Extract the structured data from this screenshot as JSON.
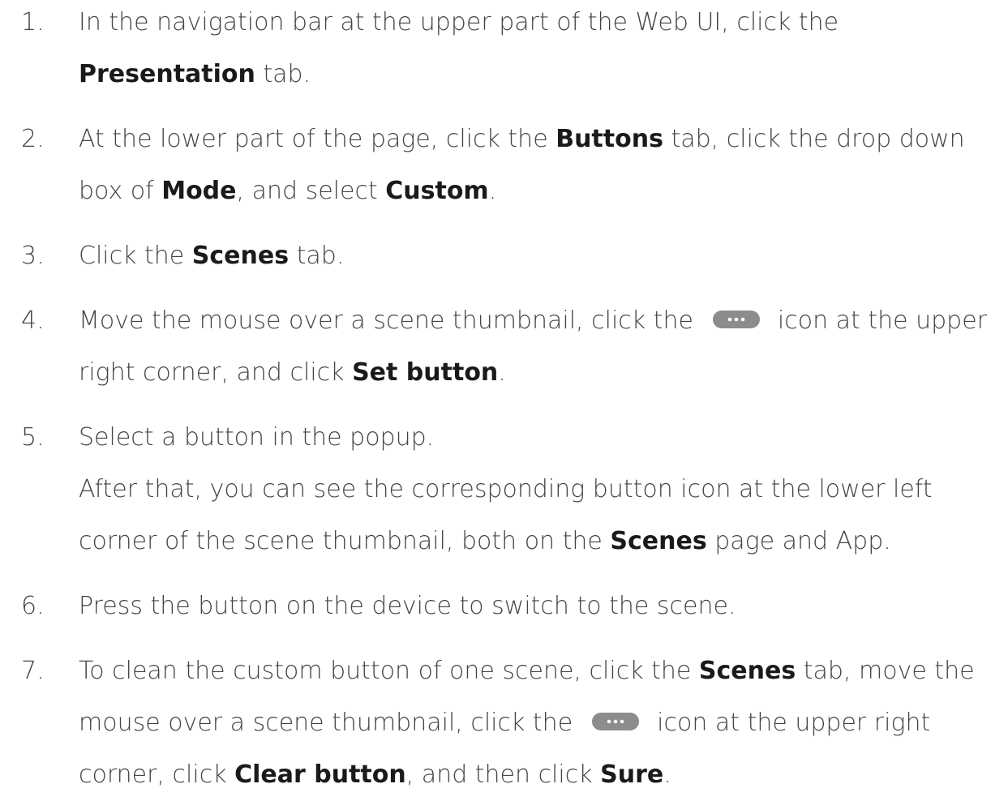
{
  "steps": [
    {
      "num": "1.",
      "lines": [
        [
          "In the navigation bar at the upper part of the Web UI, click the"
        ],
        [
          "",
          "Presentation",
          " tab."
        ]
      ]
    },
    {
      "num": "2.",
      "lines": [
        [
          "At the lower part of the page, click the ",
          "Buttons",
          " tab, click the drop down"
        ],
        [
          "box of ",
          "Mode",
          ", and select ",
          "Custom",
          "."
        ]
      ]
    },
    {
      "num": "3.",
      "lines": [
        [
          "Click the ",
          "Scenes",
          " tab."
        ]
      ]
    },
    {
      "num": "4.",
      "lines": [
        [
          "Move the mouse over a scene thumbnail, click the",
          "icon at the upper"
        ],
        [
          "right corner, and click ",
          "Set button",
          "."
        ]
      ]
    },
    {
      "num": "5.",
      "lines": [
        [
          "Select a button in the popup."
        ],
        [
          "After that, you can see the corresponding button icon at the lower left"
        ],
        [
          "corner of the scene thumbnail, both on the ",
          "Scenes",
          " page and App."
        ]
      ]
    },
    {
      "num": "6.",
      "lines": [
        [
          "Press the button on the device to switch to the scene."
        ]
      ]
    },
    {
      "num": "7.",
      "lines": [
        [
          "To clean the custom button of one scene, click the ",
          "Scenes",
          " tab, move the"
        ],
        [
          "mouse over a scene thumbnail, click the",
          "icon at the upper right"
        ],
        [
          "corner, click ",
          "Clear button",
          ", and then click ",
          "Sure",
          "."
        ]
      ]
    }
  ],
  "icons": {
    "more": "more-horizontal-icon",
    "more_color": "#8c8c8c"
  }
}
